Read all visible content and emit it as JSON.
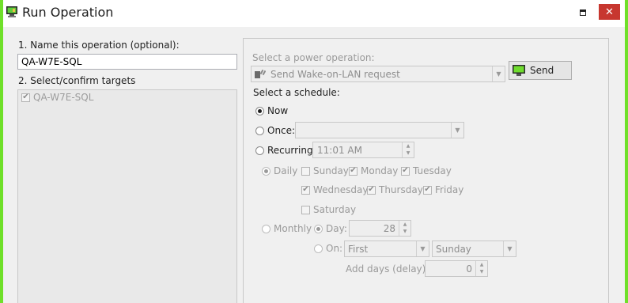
{
  "window": {
    "title": "Run Operation",
    "close_glyph": "✕",
    "frame_color": "#6fe02a",
    "close_color": "#c7372f"
  },
  "left": {
    "name_label": "1. Name this operation (optional):",
    "name_value": "QA-W7E-SQL",
    "targets_label": "2. Select/confirm targets",
    "targets": [
      {
        "label": "QA-W7E-SQL",
        "checked": true
      }
    ]
  },
  "power": {
    "label": "Select a power operation:",
    "selected": "Send Wake-on-LAN request",
    "send_label": "Send"
  },
  "schedule": {
    "label": "Select a schedule:",
    "now_label": "Now",
    "once_label": "Once:",
    "once_value": "",
    "recurring_label": "Recurring:",
    "recurring_time": "11:01 AM",
    "selected": "Now",
    "daily_label": "Daily",
    "days": {
      "sunday": {
        "label": "Sunday",
        "checked": false
      },
      "monday": {
        "label": "Monday",
        "checked": true
      },
      "tuesday": {
        "label": "Tuesday",
        "checked": true
      },
      "wednesday": {
        "label": "Wednesday",
        "checked": true
      },
      "thursday": {
        "label": "Thursday",
        "checked": true
      },
      "friday": {
        "label": "Friday",
        "checked": true
      },
      "saturday": {
        "label": "Saturday",
        "checked": false
      }
    },
    "monthly_label": "Monthly",
    "day_label": "Day:",
    "day_value": "28",
    "on_label": "On:",
    "on_ordinal": "First",
    "on_weekday": "Sunday",
    "add_days_label": "Add days (delay):",
    "add_days_value": "0"
  }
}
